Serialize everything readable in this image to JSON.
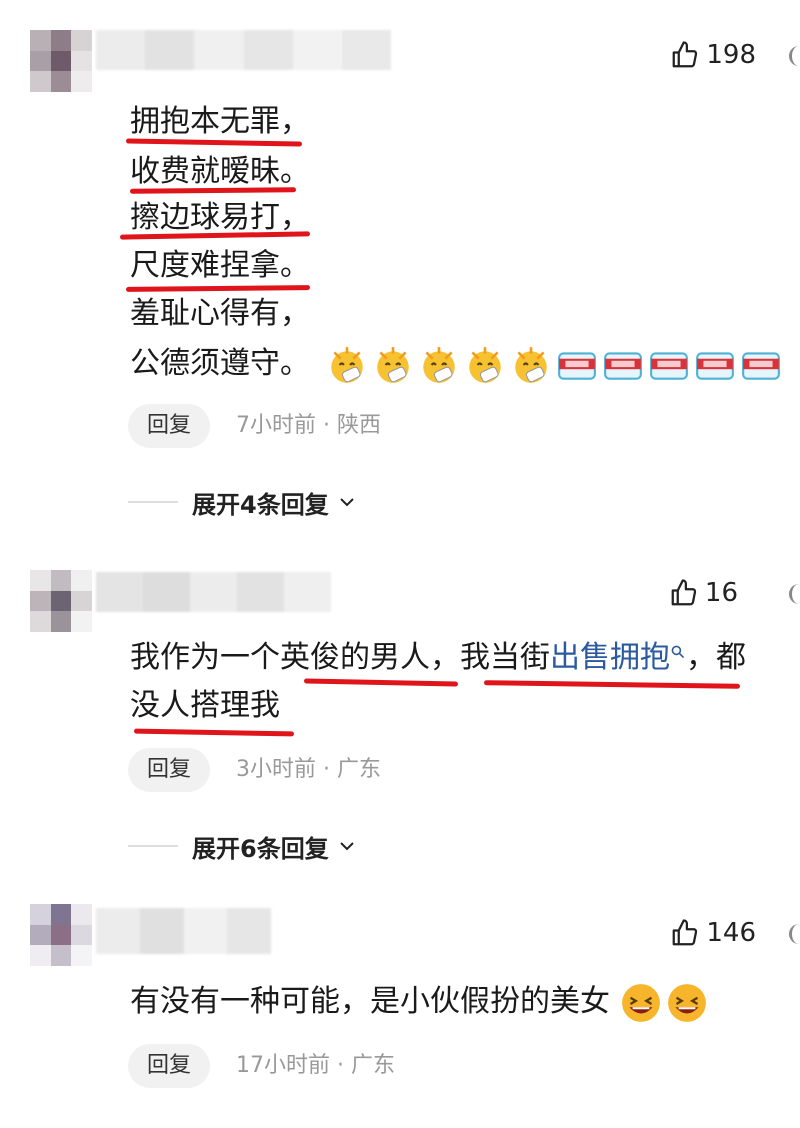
{
  "comments": [
    {
      "likes": "198",
      "lines": [
        "拥抱本无罪，",
        "收费就暧昧。",
        "擦边球易打，",
        "尺度难捏拿。",
        "羞耻心得有，",
        "公德须遵守。"
      ],
      "reply_label": "回复",
      "meta": "7小时前 · 陕西",
      "expand_label": "展开4条回复"
    },
    {
      "likes": "16",
      "text_a": "我作为一个英俊的男人，我当街",
      "link_text": "出售拥抱",
      "text_b": "，都",
      "text_line2": "没人搭理我",
      "reply_label": "回复",
      "meta": "3小时前 · 广东",
      "expand_label": "展开6条回复"
    },
    {
      "likes": "146",
      "text": "有没有一种可能，是小伙假扮的美女",
      "reply_label": "回复",
      "meta": "17小时前 · 广东"
    }
  ],
  "emoji_names": [
    "cheer-emoji",
    "cheer-emoji",
    "cheer-emoji",
    "cheer-emoji",
    "cheer-emoji",
    "detergent-emoji",
    "detergent-emoji",
    "detergent-emoji",
    "detergent-emoji",
    "detergent-emoji"
  ],
  "colors": {
    "underline": "#e0141b",
    "link": "#2b5b9e",
    "meta": "#999999",
    "reply_bg": "#f1f1f2"
  }
}
